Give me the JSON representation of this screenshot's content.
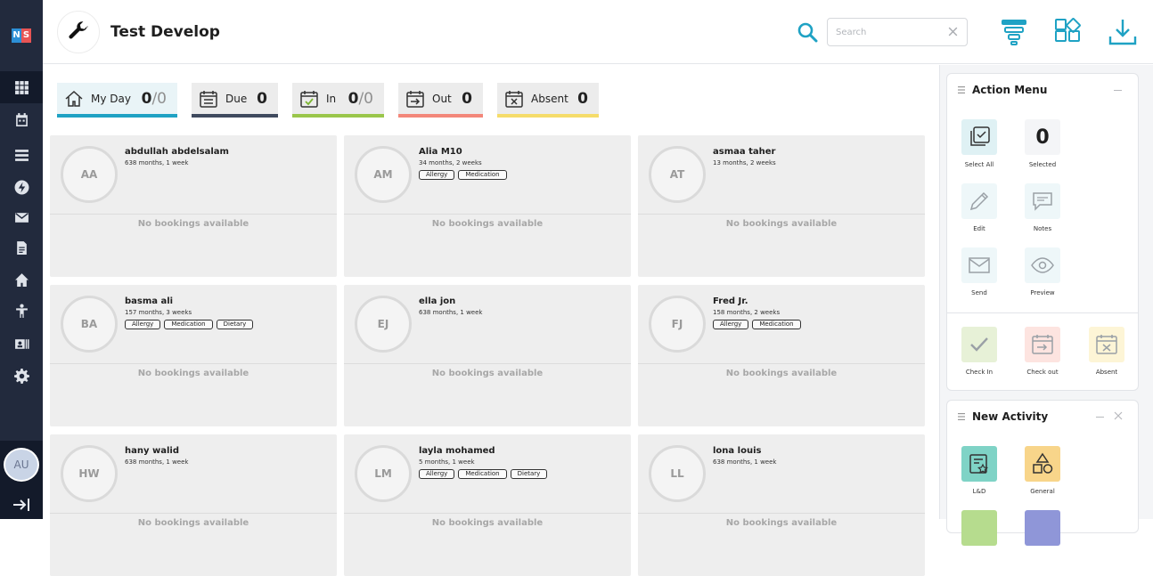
{
  "app": {
    "title": "Test Develop",
    "logo_left": "N",
    "logo_right": "S",
    "user_initials": "AU"
  },
  "search": {
    "placeholder": "Search",
    "value": ""
  },
  "stats": [
    {
      "label": "My Day",
      "value": "0",
      "total": "/0",
      "accent": "#1fa2c4"
    },
    {
      "label": "Due",
      "value": "0",
      "accent": "#3f4a5e"
    },
    {
      "label": "In",
      "value": "0",
      "total": "/0",
      "accent": "#9ac64b"
    },
    {
      "label": "Out",
      "value": "0",
      "accent": "#f3877a"
    },
    {
      "label": "Absent",
      "value": "0",
      "accent": "#f5dc6a"
    }
  ],
  "children": [
    {
      "initials": "AA",
      "name": "abdullah abdelsalam",
      "age": "638 months, 1 week",
      "tags": [],
      "bookings": "No bookings available"
    },
    {
      "initials": "AM",
      "name": "Alia M10",
      "age": "34 months, 2 weeks",
      "tags": [
        "Allergy",
        "Medication"
      ],
      "bookings": "No bookings available"
    },
    {
      "initials": "AT",
      "name": "asmaa taher",
      "age": "13 months, 2 weeks",
      "tags": [],
      "bookings": "No bookings available"
    },
    {
      "initials": "BA",
      "name": "basma ali",
      "age": "157 months, 3 weeks",
      "tags": [
        "Allergy",
        "Medication",
        "Dietary"
      ],
      "bookings": "No bookings available"
    },
    {
      "initials": "EJ",
      "name": "ella jon",
      "age": "638 months, 1 week",
      "tags": [],
      "bookings": "No bookings available"
    },
    {
      "initials": "FJ",
      "name": "Fred Jr.",
      "age": "158 months, 2 weeks",
      "tags": [
        "Allergy",
        "Medication"
      ],
      "bookings": "No bookings available"
    },
    {
      "initials": "HW",
      "name": "hany walid",
      "age": "638 months, 1 week",
      "tags": [],
      "bookings": "No bookings available"
    },
    {
      "initials": "LM",
      "name": "layla mohamed",
      "age": "5 months, 1 week",
      "tags": [
        "Allergy",
        "Medication",
        "Dietary"
      ],
      "bookings": "No bookings available"
    },
    {
      "initials": "LL",
      "name": "lona louis",
      "age": "638 months, 1 week",
      "tags": [],
      "bookings": "No bookings available"
    }
  ],
  "action_menu": {
    "title": "Action Menu",
    "select_all": "Select All",
    "selected_count": "0",
    "selected_label": "Selected",
    "edit": "Edit",
    "notes": "Notes",
    "send": "Send",
    "preview": "Preview",
    "check_in": "Check In",
    "check_out": "Check out",
    "absent": "Absent"
  },
  "new_activity": {
    "title": "New Activity",
    "ld": "L&D",
    "general": "General"
  },
  "colors": {
    "rail": "#222a3d",
    "accent_blue": "#1fa2c4",
    "tile_teal": "#dff1f4",
    "tile_green": "#e7f1d7",
    "tile_red": "#fde4e0",
    "tile_yellow": "#fdf5d6"
  }
}
